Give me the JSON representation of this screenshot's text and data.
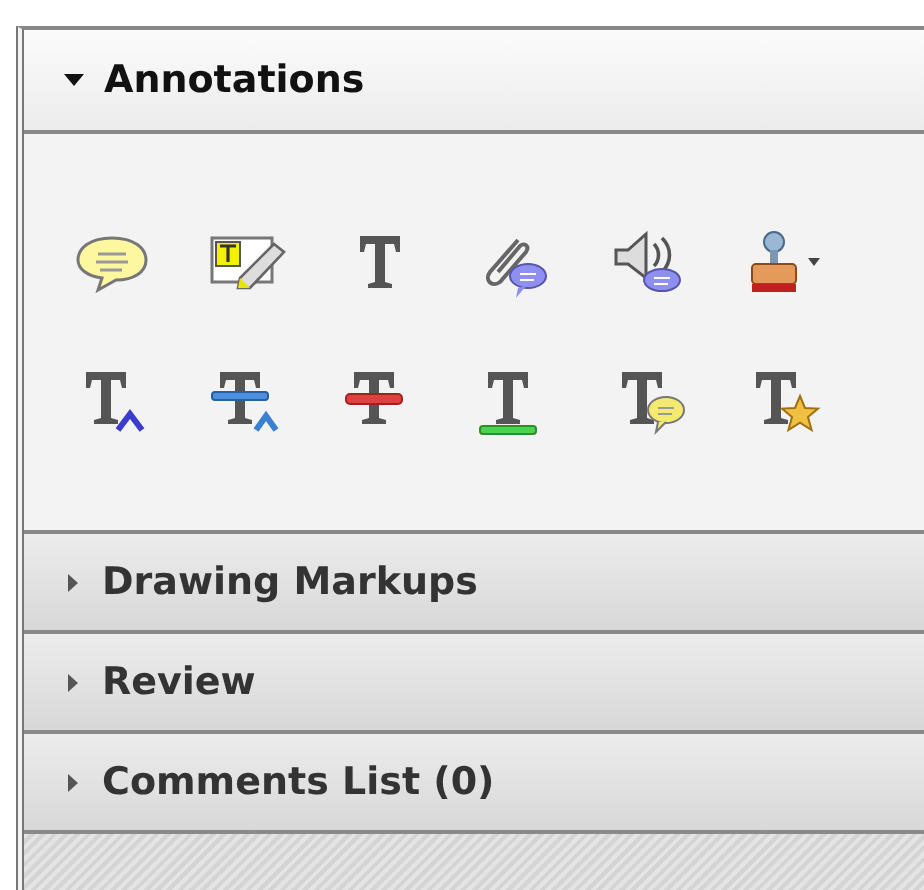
{
  "panels": [
    {
      "title": "Annotations",
      "expanded": true,
      "tool_rows": [
        [
          {
            "kind": "sticky-note"
          },
          {
            "kind": "text-box-note"
          },
          {
            "kind": "text"
          },
          {
            "kind": "attach"
          },
          {
            "kind": "audio"
          },
          {
            "kind": "stamp"
          }
        ],
        [
          {
            "kind": "insert"
          },
          {
            "kind": "replace"
          },
          {
            "kind": "strike"
          },
          {
            "kind": "underline"
          },
          {
            "kind": "text-comment"
          },
          {
            "kind": "text-star"
          }
        ]
      ]
    },
    {
      "title": "Drawing Markups",
      "expanded": false
    },
    {
      "title": "Review",
      "expanded": false
    },
    {
      "title": "Comments List (0)",
      "expanded": false
    }
  ]
}
